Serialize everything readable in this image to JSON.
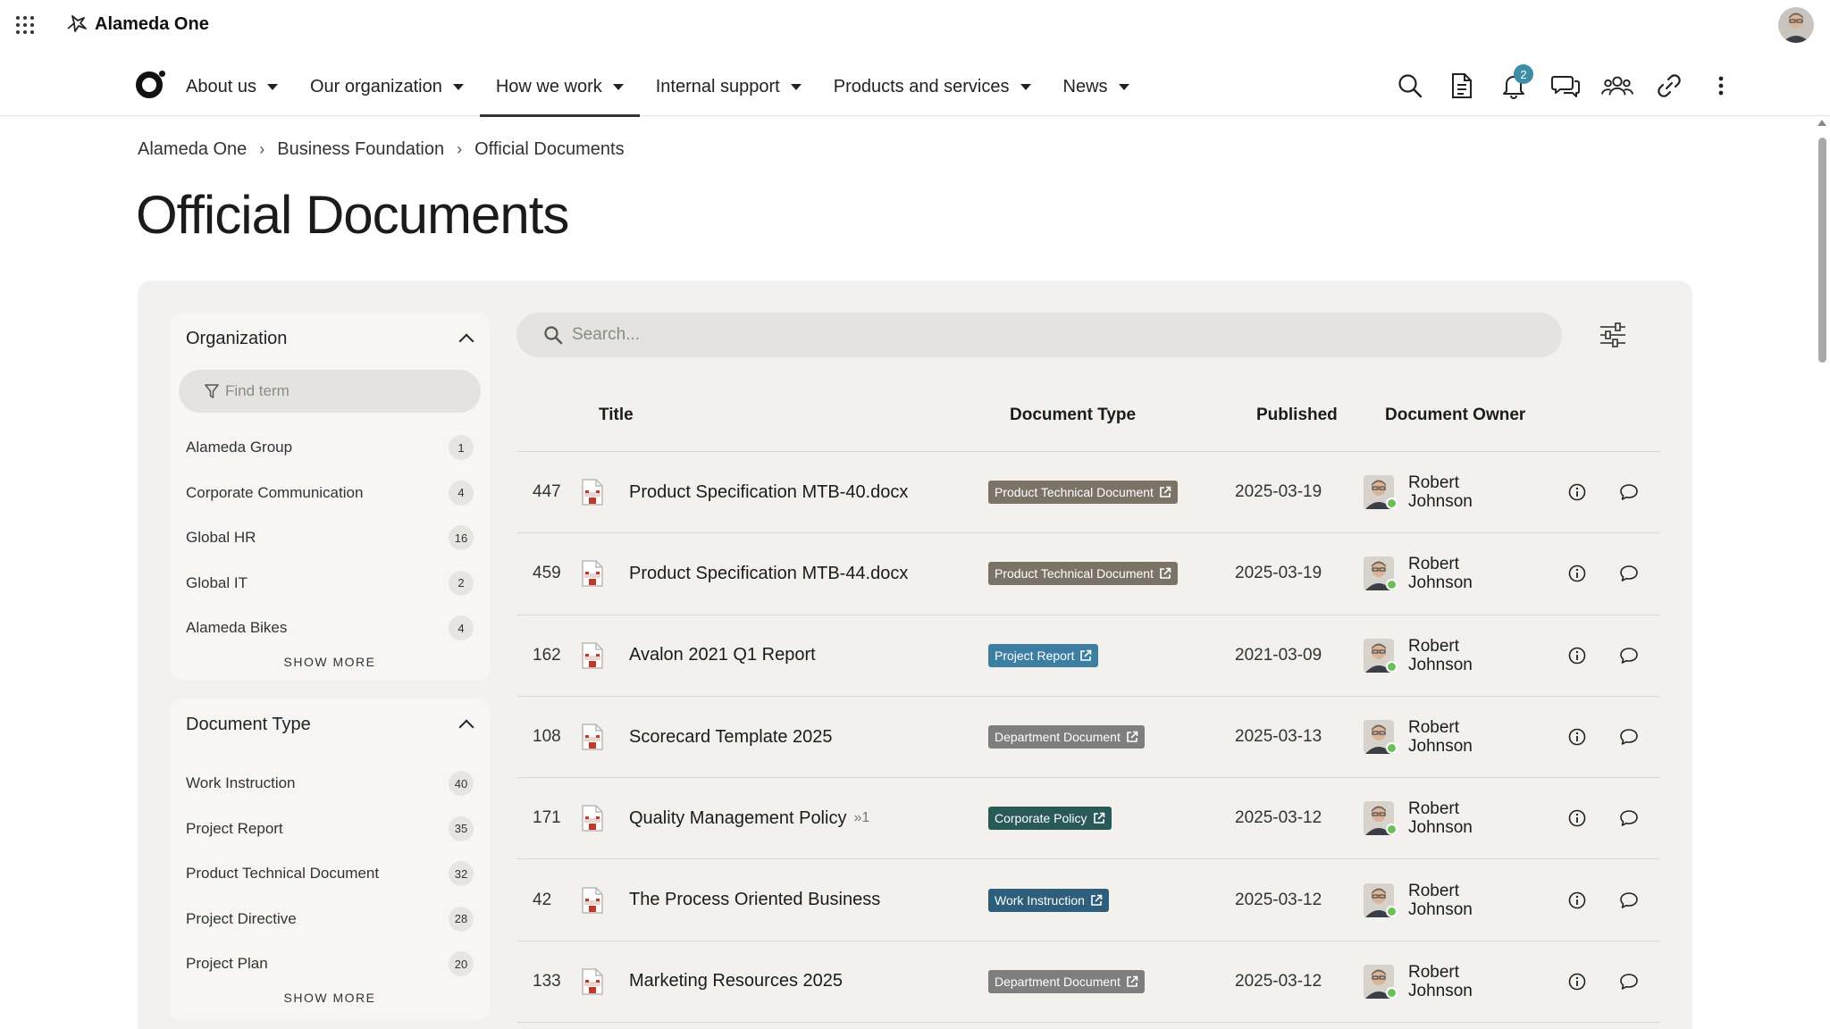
{
  "app": {
    "name": "Alameda One"
  },
  "nav": {
    "items": [
      {
        "label": "About us"
      },
      {
        "label": "Our organization"
      },
      {
        "label": "How we work"
      },
      {
        "label": "Internal support"
      },
      {
        "label": "Products and services"
      },
      {
        "label": "News"
      }
    ],
    "active": "How we work",
    "notification_count": "2"
  },
  "breadcrumb": [
    "Alameda One",
    "Business Foundation",
    "Official Documents"
  ],
  "page": {
    "title": "Official Documents"
  },
  "facets": {
    "organization": {
      "title": "Organization",
      "find_placeholder": "Find term",
      "items": [
        {
          "label": "Alameda Group",
          "count": "1"
        },
        {
          "label": "Corporate Communication",
          "count": "4"
        },
        {
          "label": "Global HR",
          "count": "16"
        },
        {
          "label": "Global IT",
          "count": "2"
        },
        {
          "label": "Alameda Bikes",
          "count": "4"
        }
      ],
      "show_more": "SHOW MORE"
    },
    "document_type": {
      "title": "Document Type",
      "items": [
        {
          "label": "Work Instruction",
          "count": "40"
        },
        {
          "label": "Project Report",
          "count": "35"
        },
        {
          "label": "Product Technical Document",
          "count": "32"
        },
        {
          "label": "Project Directive",
          "count": "28"
        },
        {
          "label": "Project Plan",
          "count": "20"
        }
      ],
      "show_more": "SHOW MORE"
    }
  },
  "search": {
    "placeholder": "Search..."
  },
  "table": {
    "headers": {
      "title": "Title",
      "type": "Document Type",
      "published": "Published",
      "owner": "Document Owner"
    },
    "rows": [
      {
        "id": "447",
        "title": "Product Specification MTB-40.docx",
        "version": "",
        "type": "Product Technical Document",
        "type_color": "#7b7466",
        "published": "2025-03-19",
        "owner": "Robert Johnson"
      },
      {
        "id": "459",
        "title": "Product Specification MTB-44.docx",
        "version": "",
        "type": "Product Technical Document",
        "type_color": "#7b7466",
        "published": "2025-03-19",
        "owner": "Robert Johnson"
      },
      {
        "id": "162",
        "title": "Avalon 2021 Q1 Report",
        "version": "",
        "type": "Project Report",
        "type_color": "#3c7fa3",
        "published": "2021-03-09",
        "owner": "Robert Johnson"
      },
      {
        "id": "108",
        "title": "Scorecard Template 2025",
        "version": "",
        "type": "Department Document",
        "type_color": "#7e7e7e",
        "published": "2025-03-13",
        "owner": "Robert Johnson"
      },
      {
        "id": "171",
        "title": "Quality Management Policy",
        "version": "1",
        "type": "Corporate Policy",
        "type_color": "#285a58",
        "published": "2025-03-12",
        "owner": "Robert Johnson"
      },
      {
        "id": "42",
        "title": "The Process Oriented Business",
        "version": "",
        "type": "Work Instruction",
        "type_color": "#2d5f7c",
        "published": "2025-03-12",
        "owner": "Robert Johnson"
      },
      {
        "id": "133",
        "title": "Marketing Resources 2025",
        "version": "",
        "type": "Department Document",
        "type_color": "#7e7e7e",
        "published": "2025-03-12",
        "owner": "Robert Johnson"
      }
    ]
  }
}
